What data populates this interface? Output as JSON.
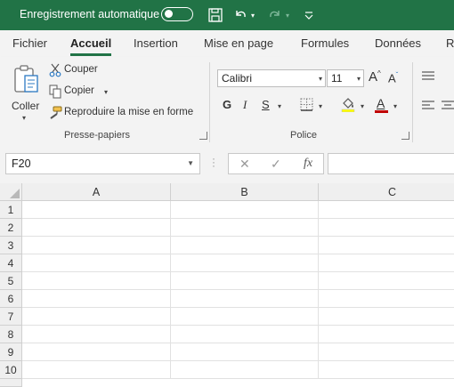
{
  "titlebar": {
    "autosave_label": "Enregistrement automatique",
    "autosave_on": false,
    "icons": [
      "toggle-switch-icon",
      "save-icon",
      "undo-icon",
      "redo-icon",
      "customize-toolbar-icon"
    ]
  },
  "tabs": [
    {
      "label": "Fichier",
      "active": false
    },
    {
      "label": "Accueil",
      "active": true
    },
    {
      "label": "Insertion",
      "active": false
    },
    {
      "label": "Mise en page",
      "active": false
    },
    {
      "label": "Formules",
      "active": false
    },
    {
      "label": "Données",
      "active": false
    },
    {
      "label": "R",
      "active": false
    }
  ],
  "clipboard": {
    "paste_label": "Coller",
    "cut_label": "Couper",
    "copy_label": "Copier",
    "format_painter_label": "Reproduire la mise en forme",
    "group_label": "Presse-papiers"
  },
  "font": {
    "font_name": "Calibri",
    "font_size": "11",
    "bold": "G",
    "italic": "I",
    "underline": "S",
    "font_color_letter": "A",
    "grow_label": "A",
    "shrink_label": "A",
    "group_label": "Police",
    "font_color": "#c00000"
  },
  "formula_bar": {
    "name_box": "F20",
    "cancel_symbol": "✕",
    "enter_symbol": "✓",
    "fx_label": "fx",
    "formula": ""
  },
  "grid": {
    "columns": [
      "A",
      "B",
      "C"
    ],
    "rows": [
      "1",
      "2",
      "3",
      "4",
      "5",
      "6",
      "7",
      "8",
      "9",
      "10"
    ]
  },
  "colors": {
    "brand": "#217346",
    "ribbon_bg": "#f3f3f3",
    "header_bg": "#efefef"
  }
}
